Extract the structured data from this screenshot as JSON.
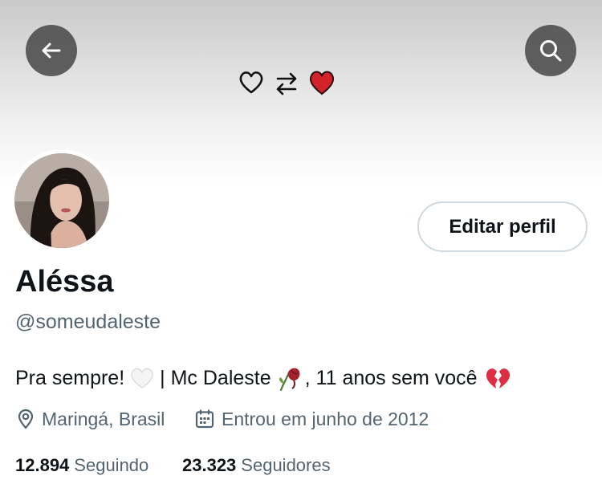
{
  "header": {
    "back_icon": "arrow-left-icon",
    "search_icon": "search-icon",
    "banner_art": [
      "heart-outline-icon",
      "swap-arrows-icon",
      "heart-filled-icon"
    ],
    "colors": {
      "heart_filled": "#d2232a",
      "button_bg": "#4b4b4b"
    }
  },
  "profile": {
    "edit_label": "Editar perfil",
    "display_name": "Aléssa",
    "handle": "@someudaleste",
    "bio": {
      "part1": "Pra sempre!",
      "part2": "| Mc Daleste",
      "part3": ", 11 anos sem você",
      "emojis": [
        "white-heart-emoji",
        "wilted-rose-emoji",
        "broken-heart-emoji"
      ]
    },
    "location_icon": "location-pin-icon",
    "location": "Maringá, Brasil",
    "joined_icon": "calendar-icon",
    "joined": "Entrou em junho de 2012",
    "following_count": "12.894",
    "following_label": "Seguindo",
    "followers_count": "23.323",
    "followers_label": "Seguidores"
  }
}
